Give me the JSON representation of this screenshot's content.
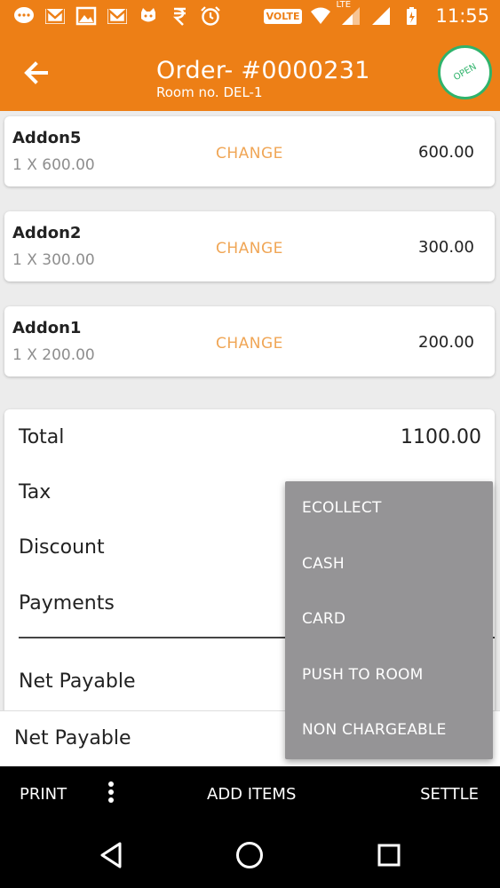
{
  "status_bar": {
    "time": "11:55",
    "volte_label": "VOLTE",
    "lte_label": "LTE",
    "left_icons": [
      "messenger-icon",
      "gmail-icon",
      "gallery-icon",
      "gmail-icon",
      "cat-icon",
      "rupee-icon",
      "alarm-icon"
    ],
    "right_icons": [
      "wifi-icon",
      "signal-icon",
      "signal-icon",
      "battery-icon"
    ]
  },
  "header": {
    "title": "Order- #0000231",
    "subtitle": "Room no. DEL-1",
    "badge": "OPEN"
  },
  "items": [
    {
      "name": "Addon5",
      "qty": "1 X 600.00",
      "change": "CHANGE",
      "price": "600.00"
    },
    {
      "name": "Addon2",
      "qty": "1 X 300.00",
      "change": "CHANGE",
      "price": "300.00"
    },
    {
      "name": "Addon1",
      "qty": "1 X 200.00",
      "change": "CHANGE",
      "price": "200.00"
    }
  ],
  "summary": {
    "total_label": "Total",
    "total_value": "1100.00",
    "tax_label": "Tax",
    "discount_label": "Discount",
    "payments_label": "Payments",
    "net_payable_label": "Net Payable"
  },
  "net_payable_bar": "Net Payable",
  "toolbar": {
    "print": "PRINT",
    "add_items": "ADD ITEMS",
    "settle": "SETTLE"
  },
  "payment_menu": [
    "ECOLLECT",
    "CASH",
    "CARD",
    "PUSH TO ROOM",
    "NON CHARGEABLE"
  ],
  "colors": {
    "brand_orange": "#ed7f16",
    "change_text": "#f0a656",
    "badge_green": "#2fb36b",
    "menu_bg": "#959496"
  }
}
